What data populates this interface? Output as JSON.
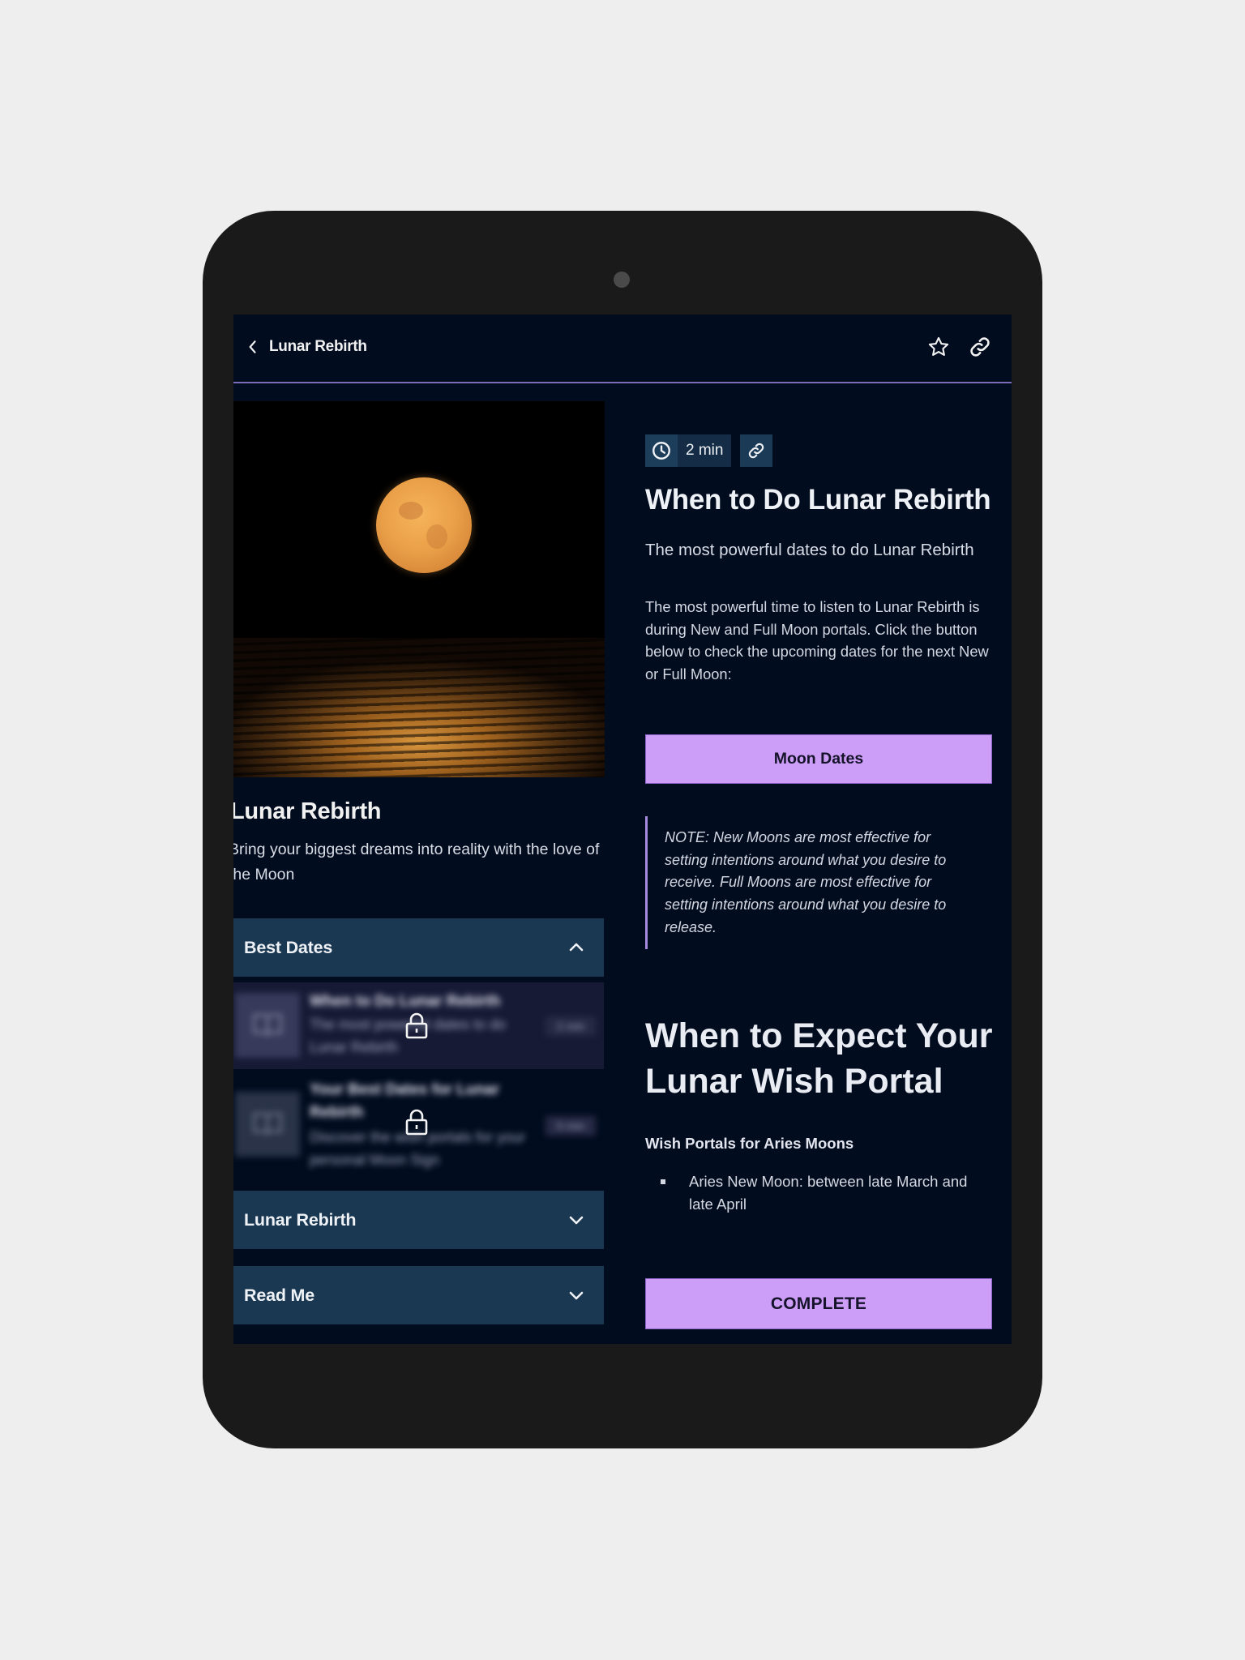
{
  "header": {
    "back_label": "Lunar Rebirth",
    "icons": {
      "back": "chevron-left-icon",
      "favorite": "star-icon",
      "share": "link-icon"
    }
  },
  "course": {
    "hero_image": "full moon over the ocean",
    "title": "Lunar Rebirth",
    "description": "Bring your biggest dreams into reality with the love of the Moon"
  },
  "sections": [
    {
      "label": "Best Dates",
      "expanded": true,
      "lessons": [
        {
          "title": "When to Do Lunar Rebirth",
          "description": "The most powerful dates to do Lunar Rebirth",
          "duration": "2 min",
          "locked": true,
          "active": true
        },
        {
          "title": "Your Best Dates for Lunar Rebirth",
          "description": "Discover the wish portals for your personal Moon Sign",
          "duration": "5 min",
          "locked": true,
          "active": false
        }
      ]
    },
    {
      "label": "Lunar Rebirth",
      "expanded": false
    },
    {
      "label": "Read Me",
      "expanded": false
    }
  ],
  "lesson": {
    "duration": "2 min",
    "title": "When to Do Lunar Rebirth",
    "subtitle": "The most powerful dates to do Lunar Rebirth",
    "body": "The most powerful time to listen to Lunar Rebirth is during New and Full Moon portals. Click the button below to check the upcoming dates for the next New or Full Moon:",
    "moon_dates_button": "Moon Dates",
    "note": "NOTE: New Moons are most effective for setting intentions around what you desire to receive. Full Moons are most effective for setting intentions around what you desire to release.",
    "section_heading": "When to Expect Your Lunar Wish Portal",
    "subheading": "Wish Portals for Aries Moons",
    "bullets": [
      "Aries New Moon: between late March and late April"
    ],
    "complete_button": "COMPLETE"
  },
  "colors": {
    "background": "#020c1f",
    "accent_button": "#cc9ef8",
    "accordion": "#1b3852",
    "divider": "#7c6bb5",
    "active_lesson": "#171a35"
  }
}
